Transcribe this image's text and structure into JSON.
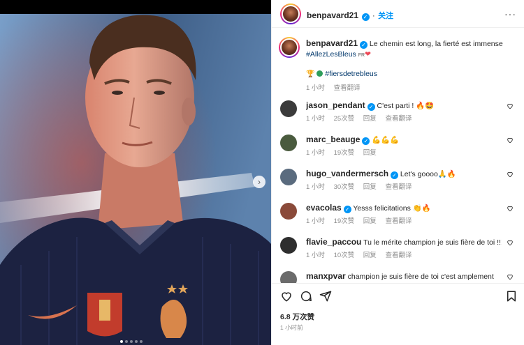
{
  "post": {
    "author": "benpavard21",
    "follow_label": "关注",
    "more_label": "···",
    "caption": {
      "text": "Le chemin est long, la fierté est immense",
      "hashtag_main": "#AllezLesBleus",
      "flag": "FR",
      "hashtag_second": "#fiersdetrebleus",
      "time": "1 小时",
      "translate": "查看翻译"
    },
    "likes": "6.8 万次赞",
    "posted": "1 小时前"
  },
  "comments": [
    {
      "user": "jason_pendant",
      "verified": true,
      "text": "C'est parti ! 🔥🤩",
      "time": "1 小时",
      "likes": "25次赞",
      "reply": "回复",
      "translate": "查看翻译",
      "avatar_color": "#3b3b3b"
    },
    {
      "user": "marc_beauge",
      "verified": true,
      "text": "💪💪💪",
      "time": "1 小时",
      "likes": "19次赞",
      "reply": "回复",
      "translate": "",
      "avatar_color": "#4a5b3e"
    },
    {
      "user": "hugo_vandermersch",
      "verified": true,
      "text": "Let's goooo🙏🔥",
      "time": "1 小时",
      "likes": "30次赞",
      "reply": "回复",
      "translate": "查看翻译",
      "avatar_color": "#5a6b7e"
    },
    {
      "user": "evacolas",
      "verified": true,
      "text": "Yesss felicitations 👏🔥",
      "time": "1 小时",
      "likes": "19次赞",
      "reply": "回复",
      "translate": "查看翻译",
      "avatar_color": "#8a4a3a"
    },
    {
      "user": "flavie_paccou",
      "verified": false,
      "text": "Tu le mérite champion je suis fière de toi !!! ❤️",
      "time": "1 小时",
      "likes": "10次赞",
      "reply": "回复",
      "translate": "查看翻译",
      "avatar_color": "#2e2e2e"
    },
    {
      "user": "manxpvar",
      "verified": false,
      "text": "champion je suis fière de toi c'est amplement",
      "time": "",
      "likes": "",
      "reply": "",
      "translate": "",
      "avatar_color": "#6b6b6b"
    }
  ],
  "icons": {
    "next": "chevron-right-icon",
    "like": "heart-icon",
    "comment": "comment-icon",
    "share": "send-icon",
    "save": "bookmark-icon"
  },
  "media": {
    "slides_total": 5,
    "slide_active": 1
  },
  "colors": {
    "accent": "#0095f6",
    "heart": "#ed4956",
    "hashtag": "#00376b"
  }
}
